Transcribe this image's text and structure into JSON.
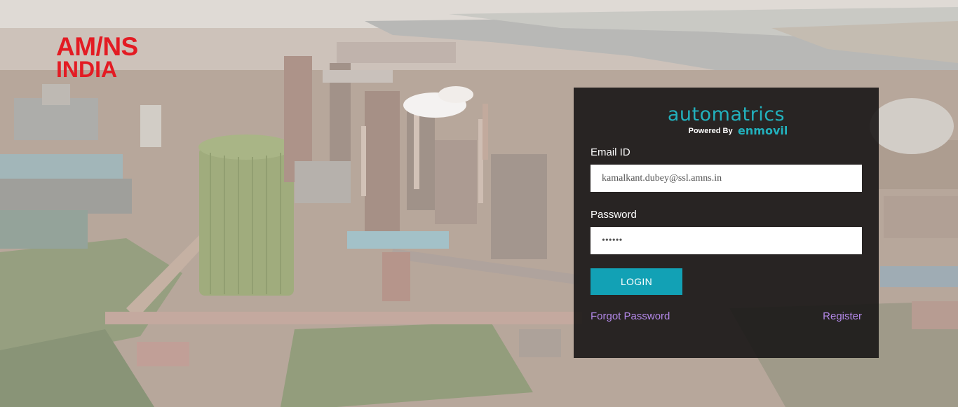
{
  "brand": {
    "line1": "AM/NS",
    "line2": "INDIA",
    "color": "#e31b23"
  },
  "product": {
    "name": "automatrics",
    "powered_by_label": "Powered By",
    "powered_by_brand": "enmovil",
    "accent_color": "#22b1bd"
  },
  "login_form": {
    "email_label": "Email ID",
    "email_value": "kamalkant.dubey@ssl.amns.in",
    "password_label": "Password",
    "password_value": "••••••",
    "login_button": "LOGIN",
    "forgot_password": "Forgot Password",
    "register": "Register",
    "button_color": "#12a1b5",
    "link_color": "#b388e8"
  }
}
